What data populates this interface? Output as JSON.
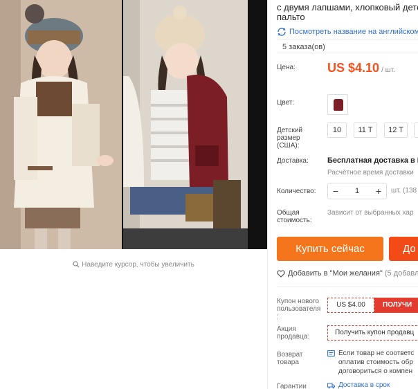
{
  "product": {
    "title_line1": "с двумя лапшами, хлопковый детск",
    "title_line2": "пальто",
    "translate_link": "Посмотреть название на английском",
    "orders": "5 заказа(ов)"
  },
  "price": {
    "label": "Цена:",
    "value": "US $4.10",
    "unit": "/ шт."
  },
  "color": {
    "label": "Цвет:",
    "swatch_color": "#7b1e25"
  },
  "size": {
    "label_line1": "Детский",
    "label_line2": "размер",
    "label_line3": "(США):",
    "options": [
      "10",
      "11 T",
      "12 T"
    ]
  },
  "shipping": {
    "label": "Доставка:",
    "title": "Бесплатная доставка в Ru",
    "estimate": "Расчётное время доставки"
  },
  "quantity": {
    "label": "Количество:",
    "minus": "−",
    "value": "1",
    "plus": "+",
    "unit": "шт. (138"
  },
  "total": {
    "label_line1": "Общая",
    "label_line2": "стоимость:",
    "value": "Зависит от выбранных хар"
  },
  "actions": {
    "buy_now": "Купить сейчас",
    "add_to_cart": "До"
  },
  "wishlist": {
    "text": "Добавить в \"Мои желания\"",
    "count": "(5 добавл"
  },
  "coupon": {
    "label_line1": "Купон нового",
    "label_line2": "пользователя",
    "label_line3": ":",
    "amount": "US $4.00",
    "get": "ПОЛУЧИ"
  },
  "promo": {
    "label_line1": "Акция",
    "label_line2": "продавца:",
    "text": "Получить купон продавц"
  },
  "returns": {
    "label_line1": "Возврат",
    "label_line2": "товара",
    "text_line1": "Если товар не соответс",
    "text_line2": "оплатив стоимость обр",
    "text_line3": "договориться о компен"
  },
  "guarantee": {
    "label": "Гарантии",
    "text": "Доставка в срок"
  },
  "gallery": {
    "zoom_hint": "Наведите курсор, чтобы увеличить"
  }
}
